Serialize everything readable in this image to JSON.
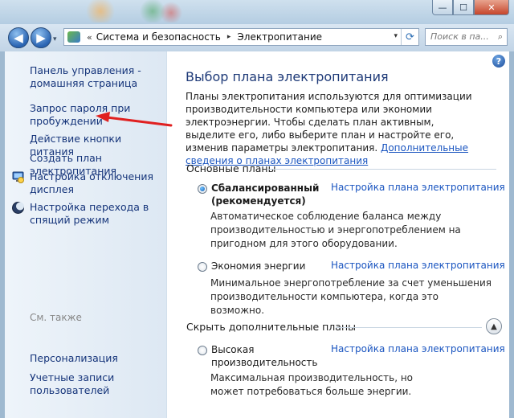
{
  "window": {
    "controls": {
      "minimize": "—",
      "maximize": "☐",
      "close": "✕"
    }
  },
  "navigation": {
    "back": "◀",
    "forward": "▶",
    "history": "▾",
    "address": {
      "prefix": "«",
      "crumbs": [
        "Система и безопасность",
        "Электропитание"
      ],
      "separator": "▸",
      "dropdown": "▾",
      "refresh": "⟳"
    },
    "search_placeholder": "Поиск в па...",
    "search_icon": "⌕"
  },
  "sidebar": {
    "items": [
      {
        "label": "Панель управления - домашняя страница",
        "icon": null
      },
      {
        "label": "Запрос пароля при пробуждении",
        "icon": null
      },
      {
        "label": "Действие кнопки питания",
        "icon": null
      },
      {
        "label": "Создать план электропитания",
        "icon": null
      },
      {
        "label": "Настройка отключения дисплея",
        "icon": "monitor-icon"
      },
      {
        "label": "Настройка перехода в спящий режим",
        "icon": "moon-icon"
      }
    ],
    "see_also": {
      "title": "См. также",
      "items": [
        {
          "label": "Персонализация"
        },
        {
          "label": "Учетные записи пользователей"
        }
      ]
    }
  },
  "main": {
    "help": "?",
    "title": "Выбор плана электропитания",
    "description": "Планы электропитания используются для оптимизации производительности компьютера или экономии электроэнергии. Чтобы сделать план активным, выделите его, либо выберите план и настройте его, изменив параметры электропитания. ",
    "description_link": "Дополнительные сведения о планах электропитания",
    "basic_plans": {
      "header": "Основные планы",
      "plans": [
        {
          "name": "Сбалансированный (рекомендуется)",
          "selected": true,
          "link": "Настройка плана электропитания",
          "description": "Автоматическое соблюдение баланса между производительностью и энергопотреблением на пригодном для этого оборудовании."
        },
        {
          "name": "Экономия энергии",
          "selected": false,
          "link": "Настройка плана электропитания",
          "description": "Минимальное энергопотребление за счет уменьшения производительности компьютера, когда это возможно."
        }
      ]
    },
    "extra_plans": {
      "header": "Скрыть дополнительные планы",
      "toggle": "▲",
      "plans": [
        {
          "name": "Высокая производительность",
          "selected": false,
          "link": "Настройка плана электропитания",
          "description": "Максимальная производительность, но может потребоваться больше энергии."
        }
      ]
    }
  },
  "colors": {
    "link": "#15347a",
    "accent_link": "#1a55c0",
    "annotation_arrow": "#e02020"
  }
}
